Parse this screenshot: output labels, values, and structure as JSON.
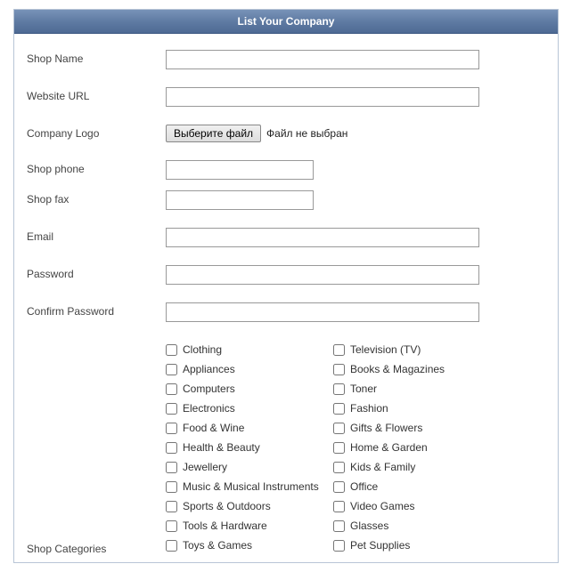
{
  "header": {
    "title": "List Your Company"
  },
  "labels": {
    "shop_name": "Shop Name",
    "website_url": "Website URL",
    "company_logo": "Company Logo",
    "shop_phone": "Shop phone",
    "shop_fax": "Shop fax",
    "email": "Email",
    "password": "Password",
    "confirm_password": "Confirm Password",
    "shop_categories": "Shop Categories"
  },
  "file": {
    "button_label": "Выберите файл",
    "status_text": "Файл не выбран"
  },
  "values": {
    "shop_name": "",
    "website_url": "",
    "shop_phone": "",
    "shop_fax": "",
    "email": "",
    "password": "",
    "confirm_password": ""
  },
  "categories": {
    "col1": [
      "Clothing",
      "Appliances",
      "Computers",
      "Electronics",
      "Food & Wine",
      "Health & Beauty",
      "Jewellery",
      "Music & Musical Instruments",
      "Sports & Outdoors",
      "Tools & Hardware",
      "Toys & Games"
    ],
    "col2": [
      "Television (TV)",
      "Books & Magazines",
      "Toner",
      "Fashion",
      "Gifts & Flowers",
      "Home & Garden",
      "Kids & Family",
      "Office",
      "Video Games",
      "Glasses",
      "Pet Supplies"
    ]
  }
}
